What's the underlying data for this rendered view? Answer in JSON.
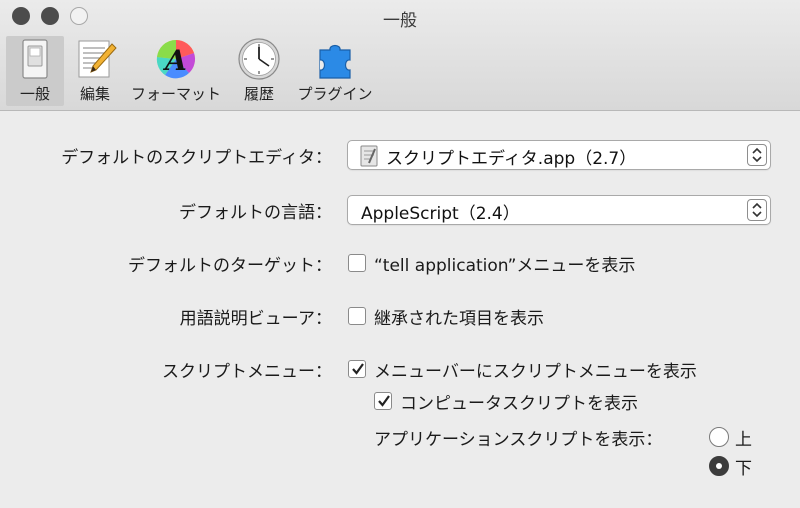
{
  "window": {
    "title": "一般"
  },
  "toolbar": {
    "items": [
      {
        "label": "一般",
        "icon": "general-switch-icon",
        "selected": true
      },
      {
        "label": "編集",
        "icon": "edit-pencil-icon",
        "selected": false
      },
      {
        "label": "フォーマット",
        "icon": "format-font-icon",
        "selected": false
      },
      {
        "label": "履歴",
        "icon": "history-clock-icon",
        "selected": false
      },
      {
        "label": "プラグイン",
        "icon": "plugin-puzzle-icon",
        "selected": false
      }
    ]
  },
  "settings": {
    "default_editor": {
      "label": "デフォルトのスクリプトエディタ：",
      "value": "スクリプトエディタ.app（2.7）"
    },
    "default_language": {
      "label": "デフォルトの言語：",
      "value": "AppleScript（2.4）"
    },
    "default_target": {
      "label": "デフォルトのターゲット：",
      "option": "“tell application”メニューを表示",
      "checked": false
    },
    "glossary_viewer": {
      "label": "用語説明ビューア：",
      "option": "継承された項目を表示",
      "checked": false
    },
    "script_menu": {
      "label": "スクリプトメニュー：",
      "show_in_menubar": {
        "text": "メニューバーにスクリプトメニューを表示",
        "checked": true
      },
      "computer_scripts": {
        "text": "コンピュータスクリプトを表示",
        "checked": true
      },
      "app_scripts_label": "アプリケーションスクリプトを表示：",
      "position_options": [
        {
          "text": "上",
          "selected": false
        },
        {
          "text": "下",
          "selected": true
        }
      ]
    }
  }
}
